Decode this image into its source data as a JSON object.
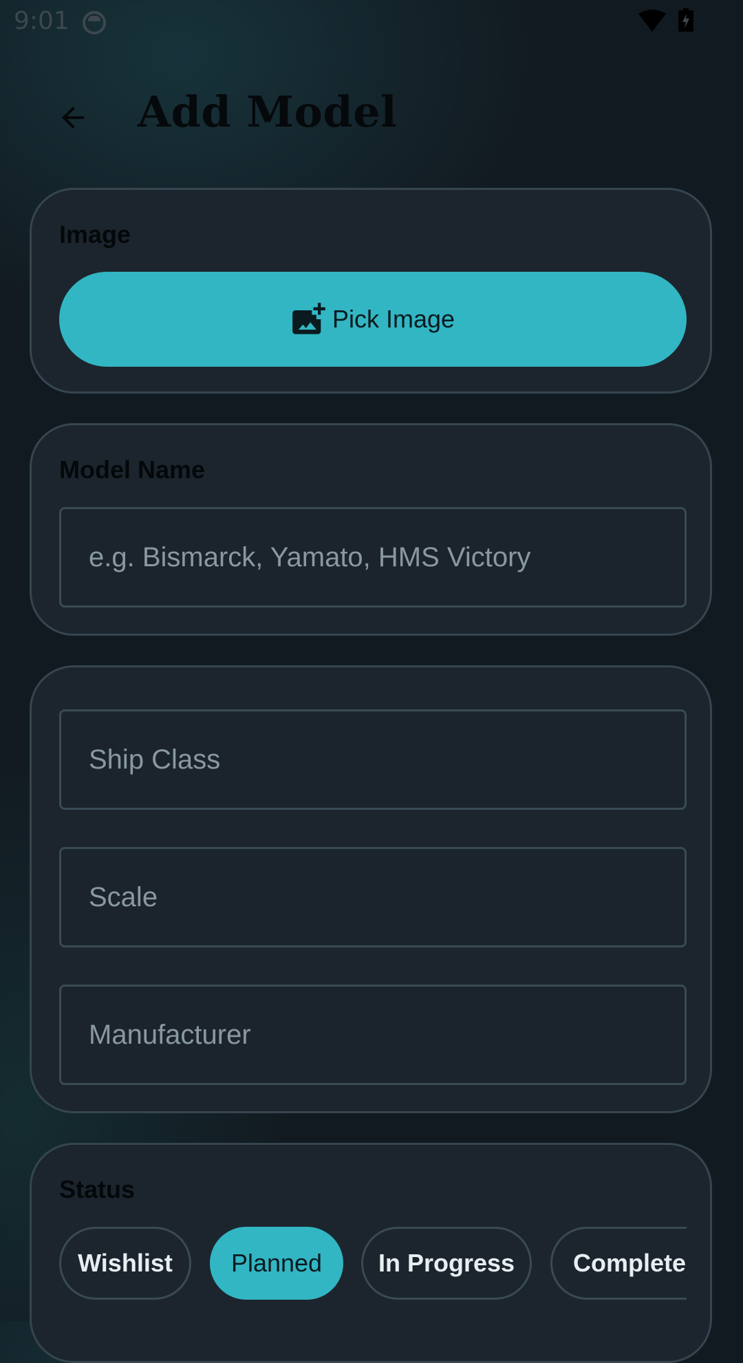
{
  "status_bar": {
    "time": "9:01"
  },
  "header": {
    "title": "Add Model"
  },
  "image_card": {
    "label": "Image",
    "pick_button_label": "Pick Image"
  },
  "name_card": {
    "label": "Model Name",
    "placeholder": "e.g. Bismarck, Yamato, HMS Victory",
    "value": ""
  },
  "details_card": {
    "ship_class_placeholder": "Ship Class",
    "scale_placeholder": "Scale",
    "manufacturer_placeholder": "Manufacturer"
  },
  "status_card": {
    "label": "Status",
    "options": [
      "Wishlist",
      "Planned",
      "In Progress",
      "Completed"
    ],
    "selected": "Planned"
  },
  "colors": {
    "accent": "#32b6c3",
    "card_background": "#1c252e",
    "page_background": "#121a21"
  }
}
